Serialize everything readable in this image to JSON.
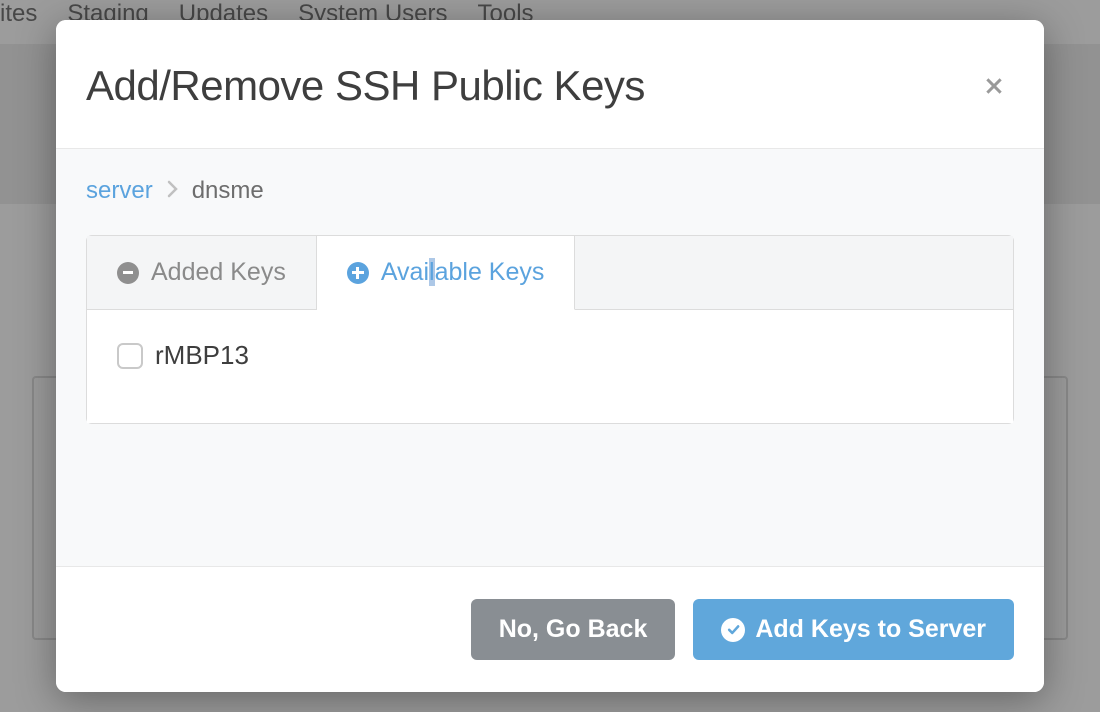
{
  "nav": {
    "items": [
      "ites",
      "Staging",
      "Updates",
      "System Users",
      "Tools"
    ]
  },
  "modal": {
    "title": "Add/Remove SSH Public Keys",
    "breadcrumb": {
      "root": "server",
      "current": "dnsme"
    },
    "tabs": {
      "added": "Added Keys",
      "available_pre": "Avai",
      "available_mid": "l",
      "available_post": "able Keys"
    },
    "keys": [
      {
        "label": "rMBP13",
        "checked": false
      }
    ],
    "footer": {
      "cancel": "No, Go Back",
      "confirm": "Add Keys to Server"
    }
  }
}
